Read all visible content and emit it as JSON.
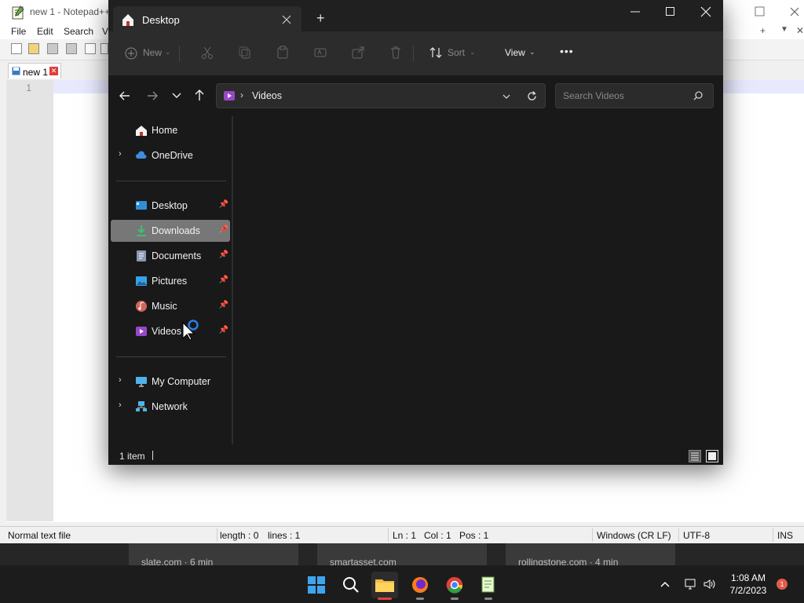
{
  "notepad": {
    "title": "new 1 - Notepad++",
    "menu": [
      "File",
      "Edit",
      "Search",
      "V"
    ],
    "tab_label": "new 1",
    "line_number": "1",
    "status": {
      "type": "Normal text file",
      "length": "length : 0",
      "lines": "lines : 1",
      "ln": "Ln : 1",
      "col": "Col : 1",
      "pos": "Pos : 1",
      "eol": "Windows (CR LF)",
      "encoding": "UTF-8",
      "mode": "INS"
    }
  },
  "explorer": {
    "tab_title": "Desktop",
    "new_tab": "+",
    "window_controls": [
      "—",
      "☐",
      "✕"
    ],
    "toolbar": {
      "new": "New",
      "sort": "Sort",
      "view": "View",
      "more": "•••"
    },
    "address": {
      "location": "Videos",
      "search_placeholder": "Search Videos"
    },
    "nav": {
      "home": "Home",
      "onedrive": "OneDrive",
      "desktop": "Desktop",
      "downloads": "Downloads",
      "documents": "Documents",
      "pictures": "Pictures",
      "music": "Music",
      "videos": "Videos",
      "my_computer": "My Computer",
      "network": "Network"
    },
    "status": "1 item"
  },
  "thumbnails": [
    "slate.com · 6 min",
    "smartasset.com",
    "rollingstone.com · 4 min"
  ],
  "taskbar": {
    "time": "1:08 AM",
    "date": "7/2/2023",
    "notification_count": "1"
  },
  "colors": {
    "explorer_bg": "#191919",
    "toolbar_bg": "#2c2c2c",
    "selection": "#777777",
    "accent_red": "#e0413a"
  }
}
